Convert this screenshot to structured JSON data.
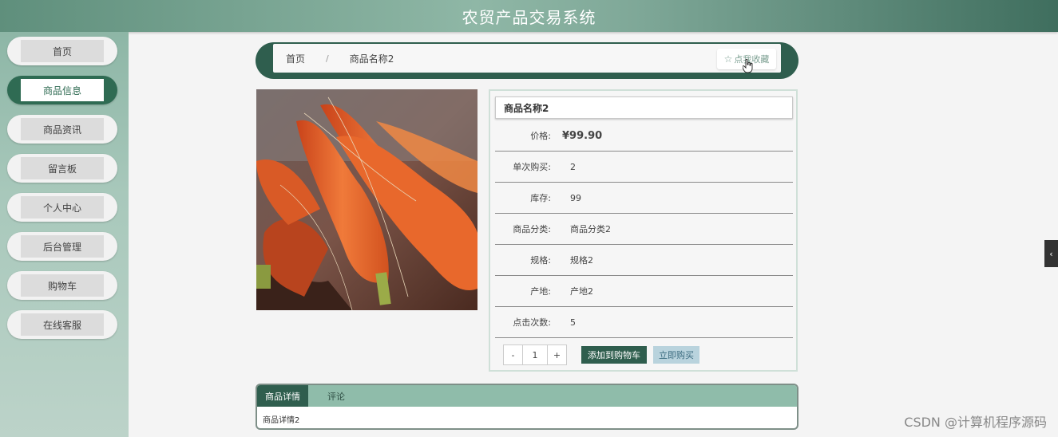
{
  "header": {
    "title": "农贸产品交易系统"
  },
  "sidebar": {
    "items": [
      {
        "label": "首页",
        "active": false
      },
      {
        "label": "商品信息",
        "active": true
      },
      {
        "label": "商品资讯",
        "active": false
      },
      {
        "label": "留言板",
        "active": false
      },
      {
        "label": "个人中心",
        "active": false
      },
      {
        "label": "后台管理",
        "active": false
      },
      {
        "label": "购物车",
        "active": false
      },
      {
        "label": "在线客服",
        "active": false
      }
    ]
  },
  "breadcrumb": {
    "home": "首页",
    "separator": "/",
    "current": "商品名称2",
    "favorite_label": "点我收藏",
    "favorite_icon": "star-icon"
  },
  "product": {
    "name": "商品名称2",
    "image": "carrot-photo",
    "rows": [
      {
        "label": "价格:",
        "value": "¥99.90"
      },
      {
        "label": "单次购买:",
        "value": "2"
      },
      {
        "label": "库存:",
        "value": "99"
      },
      {
        "label": "商品分类:",
        "value": "商品分类2"
      },
      {
        "label": "规格:",
        "value": "规格2"
      },
      {
        "label": "产地:",
        "value": "产地2"
      },
      {
        "label": "点击次数:",
        "value": "5"
      }
    ],
    "quantity": {
      "minus": "-",
      "value": "1",
      "plus": "+"
    },
    "add_to_cart": "添加到购物车",
    "buy_now": "立即购买"
  },
  "tabs": {
    "items": [
      {
        "label": "商品详情",
        "active": true
      },
      {
        "label": "评论",
        "active": false
      }
    ],
    "content": "商品详情2"
  },
  "side_toggle": {
    "icon": "chevron-left-icon",
    "glyph": "‹"
  },
  "watermark": "CSDN @计算机程序源码",
  "colors": {
    "primary": "#2f5e4e",
    "accent": "#8fbcaa",
    "buy": "#b9d3dd"
  }
}
